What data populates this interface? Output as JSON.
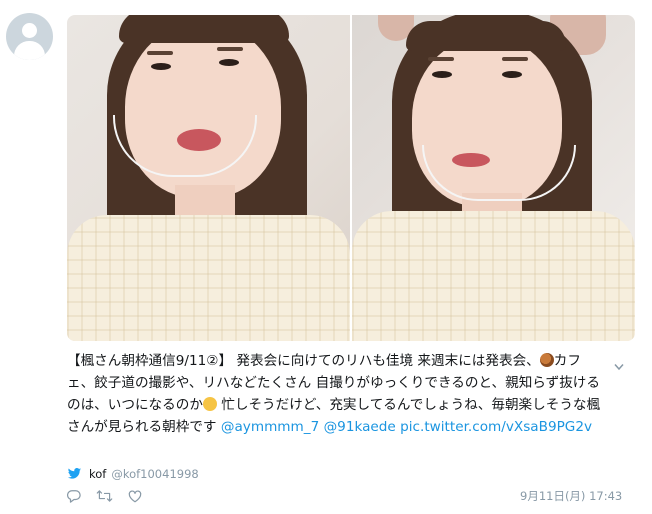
{
  "tweet": {
    "text_segments": [
      "【楓さん朝枠通信9/11②】 発表会に向けてのリハも佳境 来週末には発表会、",
      "カフェ、餃子道の撮影や、リハなどたくさん 自撮りがゆっくりできるのと、親知らず抜けるのは、いつになるのか",
      " 忙しそうだけど、充実してるんでしょうね、毎朝楽しそうな楓さんが見られる朝枠です "
    ],
    "mentions": [
      "@aymmmm_7",
      "@91kaede"
    ],
    "pic_link": "pic.twitter.com/vXsaB9PG2v",
    "emojis": [
      "snail-emoji",
      "thinking-face-emoji"
    ]
  },
  "source": {
    "name": "kof",
    "handle": "@kof10041998",
    "icon": "twitter-bird-icon"
  },
  "actions": [
    {
      "name": "reply-icon"
    },
    {
      "name": "retweet-icon"
    },
    {
      "name": "like-icon"
    }
  ],
  "timestamp": "9月11日(月) 17:43",
  "colors": {
    "link": "#1b95e0",
    "meta": "#8899a6",
    "text": "#14171a",
    "avatar_bg": "#ccd6dd"
  }
}
